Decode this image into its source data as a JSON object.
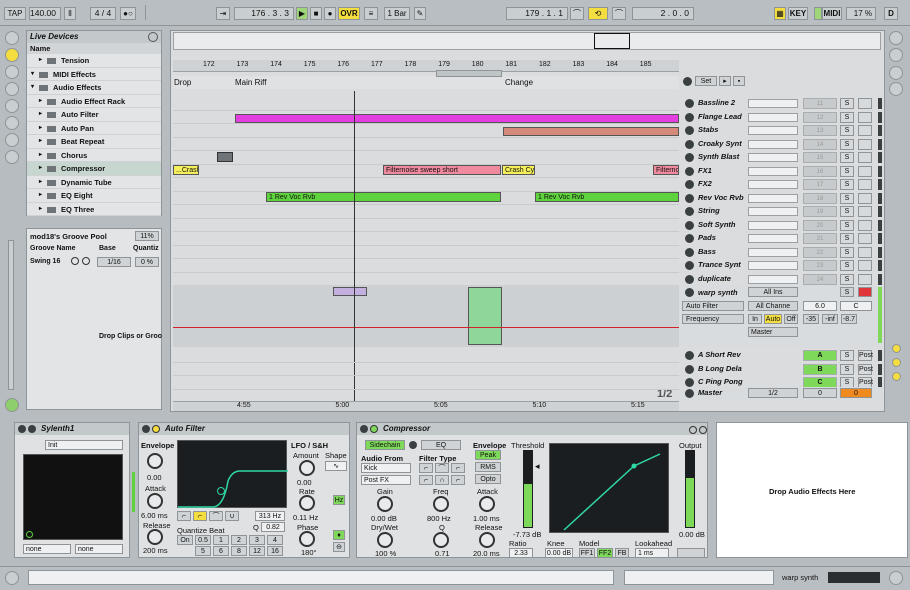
{
  "transport": {
    "tap": "TAP",
    "tempo": "140.00",
    "meter": "4 / 4",
    "position": "176 .  3 .  3",
    "ovr": "OVR",
    "quant": "1 Bar",
    "loop_start": "179 .  1 .  1",
    "loop_length": "2 .  0 .  0",
    "key": "KEY",
    "midi": "MIDI",
    "cpu": "17 %",
    "d": "D"
  },
  "browser": {
    "title": "Live Devices",
    "col_name": "Name",
    "items": [
      {
        "label": "Tension",
        "indent": 2
      },
      {
        "label": "MIDI Effects",
        "indent": 1
      },
      {
        "label": "Audio Effects",
        "indent": 1
      },
      {
        "label": "Audio Effect Rack",
        "indent": 2
      },
      {
        "label": "Auto Filter",
        "indent": 2
      },
      {
        "label": "Auto Pan",
        "indent": 2
      },
      {
        "label": "Beat Repeat",
        "indent": 2
      },
      {
        "label": "Chorus",
        "indent": 2
      },
      {
        "label": "Compressor",
        "indent": 2,
        "selected": true
      },
      {
        "label": "Dynamic Tube",
        "indent": 2
      },
      {
        "label": "EQ Eight",
        "indent": 2
      },
      {
        "label": "EQ Three",
        "indent": 2
      }
    ]
  },
  "groove": {
    "title": "mod18's Groove Pool",
    "percent": "11%",
    "col_name": "Groove Name",
    "col_base": "Base",
    "col_quant": "Quantiz",
    "row_name": "Swing 16",
    "row_base": "1/16",
    "row_quant": "0 %",
    "drop": "Drop Clips or Groo"
  },
  "arrangement": {
    "bars": [
      "172",
      "173",
      "174",
      "175",
      "176",
      "177",
      "178",
      "179",
      "180",
      "181",
      "182",
      "183",
      "184",
      "185"
    ],
    "locators": [
      "Drop",
      "Main Riff",
      "Change"
    ],
    "set_label": "Set",
    "times": [
      "4:55",
      "5:00",
      "5:05",
      "5:10",
      "5:15"
    ],
    "page": "1/2",
    "clips": {
      "crash1": "...Crash",
      "filternoise": "Filternoise sweep short",
      "crashcy": "Crash Cy",
      "filterno2": "Filterno",
      "revvoc1": "1 Rev Voc Rvb",
      "revvoc2": "1 Rev Voc Rvb"
    },
    "tracks": [
      {
        "name": "Bassline 2",
        "num": "11"
      },
      {
        "name": "Flange Lead",
        "num": "12"
      },
      {
        "name": "Stabs",
        "num": "13"
      },
      {
        "name": "Croaky Synt",
        "num": "14"
      },
      {
        "name": "Synth Blast",
        "num": "15"
      },
      {
        "name": "FX1",
        "num": "16"
      },
      {
        "name": "FX2",
        "num": "17"
      },
      {
        "name": "Rev Voc Rvb",
        "num": "18"
      },
      {
        "name": "String",
        "num": "19"
      },
      {
        "name": "Soft Synth",
        "num": "20"
      },
      {
        "name": "Pads",
        "num": "21"
      },
      {
        "name": "Bass",
        "num": "22"
      },
      {
        "name": "Trance Synt",
        "num": "23"
      },
      {
        "name": "duplicate",
        "num": "24"
      }
    ],
    "warp": {
      "name": "warp synth",
      "input": "All Ins",
      "device": "Auto Filter",
      "channel": "All Channe",
      "param": "Frequency",
      "vol": "6.0",
      "pan": "C",
      "in": "In",
      "auto": "Auto",
      "off": "Off",
      "send1": "-35",
      "send2": "-inf",
      "send3": "-8.7",
      "out": "Master"
    },
    "returns": [
      {
        "name": "A Short Rev",
        "letter": "A"
      },
      {
        "name": "B Long Dela",
        "letter": "B"
      },
      {
        "name": "C Ping Pong",
        "letter": "C"
      }
    ],
    "post": "Post",
    "master": {
      "name": "Master",
      "cue": "1/2",
      "vol": "0",
      "pan": "0"
    }
  },
  "devices": {
    "sylenth": {
      "title": "Sylenth1",
      "preset": "Init",
      "sel1": "none",
      "sel2": "none"
    },
    "autofilter": {
      "title": "Auto Filter",
      "envelope": "Envelope",
      "env_val": "0.00",
      "attack": "Attack",
      "attack_val": "6.00 ms",
      "release": "Release",
      "release_val": "200 ms",
      "freq_val": "313 Hz",
      "q_label": "Q",
      "q_val": "0.82",
      "quant_beat": "Quantize Beat",
      "q_buttons": [
        "On",
        "0.5",
        "1",
        "2",
        "3",
        "4",
        "5",
        "6",
        "8",
        "12",
        "16"
      ],
      "lfo": "LFO / S&H",
      "amount": "Amount",
      "amount_val": "0.00",
      "shape": "Shape",
      "rate": "Rate",
      "rate_val": "0.11 Hz",
      "hz": "Hz",
      "phase": "Phase",
      "phase_val": "180°"
    },
    "compressor": {
      "title": "Compressor",
      "sidechain": "Sidechain",
      "eq": "EQ",
      "audio_from": "Audio From",
      "from_val": "Kick",
      "post_fx": "Post FX",
      "gain": "Gain",
      "gain_val": "0.00 dB",
      "drywet": "Dry/Wet",
      "drywet_val": "100 %",
      "filter_type": "Filter Type",
      "freq": "Freq",
      "freq_val": "800 Hz",
      "q": "Q",
      "q_val": "0.71",
      "envelope": "Envelope",
      "peak": "Peak",
      "rms": "RMS",
      "opto": "Opto",
      "attack": "Attack",
      "attack_val": "1.00 ms",
      "release": "Release",
      "release_val": "20.0 ms",
      "threshold": "Threshold",
      "thresh_val": "-7.73 dB",
      "ratio": "Ratio",
      "ratio_val": "2.33",
      "knee": "Knee",
      "knee_val": "0.00 dB",
      "model": "Model",
      "ff1": "FF1",
      "ff2": "FF2",
      "fb": "FB",
      "lookahead": "Lookahead",
      "look_val": "1 ms",
      "output": "Output",
      "out_val": "0.00 dB"
    },
    "drop_area": "Drop Audio Effects Here"
  },
  "status": {
    "track": "warp synth"
  }
}
